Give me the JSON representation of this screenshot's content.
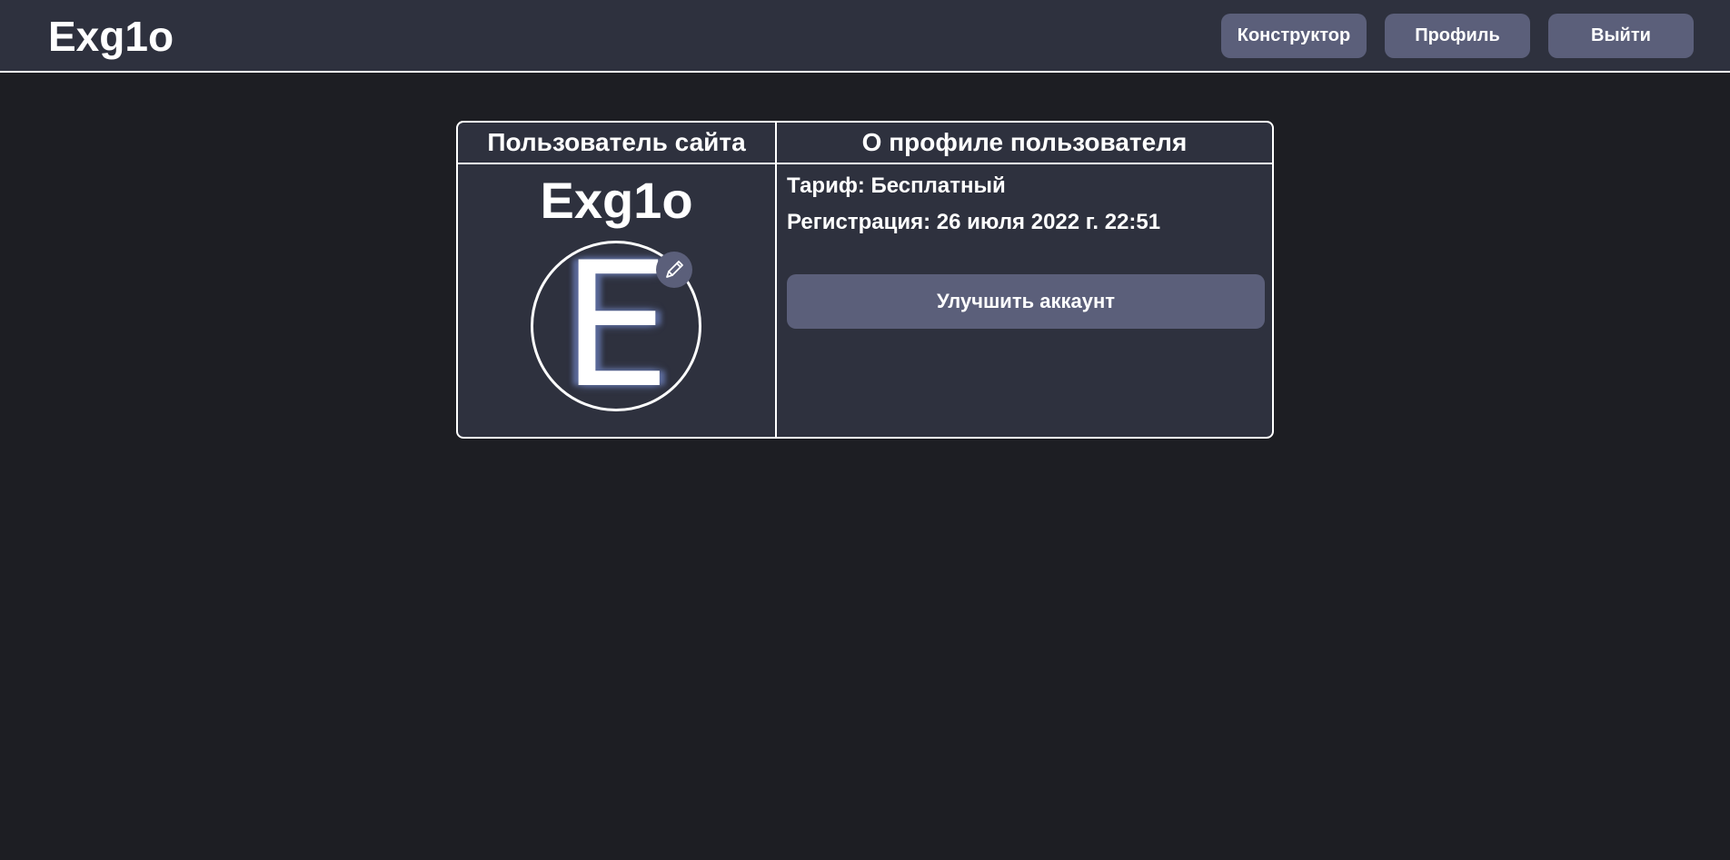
{
  "header": {
    "logo": "Exg1o",
    "nav": {
      "constructor_label": "Конструктор",
      "profile_label": "Профиль",
      "logout_label": "Выйти"
    }
  },
  "profile_table": {
    "headers": {
      "user": "Пользователь сайта",
      "about": "О профиле пользователя"
    },
    "username": "Exg1o",
    "avatar": {
      "letter": "E",
      "edit_icon": "pencil-icon"
    },
    "tariff": {
      "label": "Тариф:",
      "value": "Бесплатный"
    },
    "registration": {
      "label": "Регистрация:",
      "value": "26 июля 2022 г. 22:51"
    },
    "upgrade_label": "Улучшить аккаунт"
  },
  "colors": {
    "page_background": "#1d1e23",
    "panel_background": "#2e313e",
    "button_background": "#5b5f7a",
    "border": "#ffffff",
    "text": "#ffffff"
  }
}
